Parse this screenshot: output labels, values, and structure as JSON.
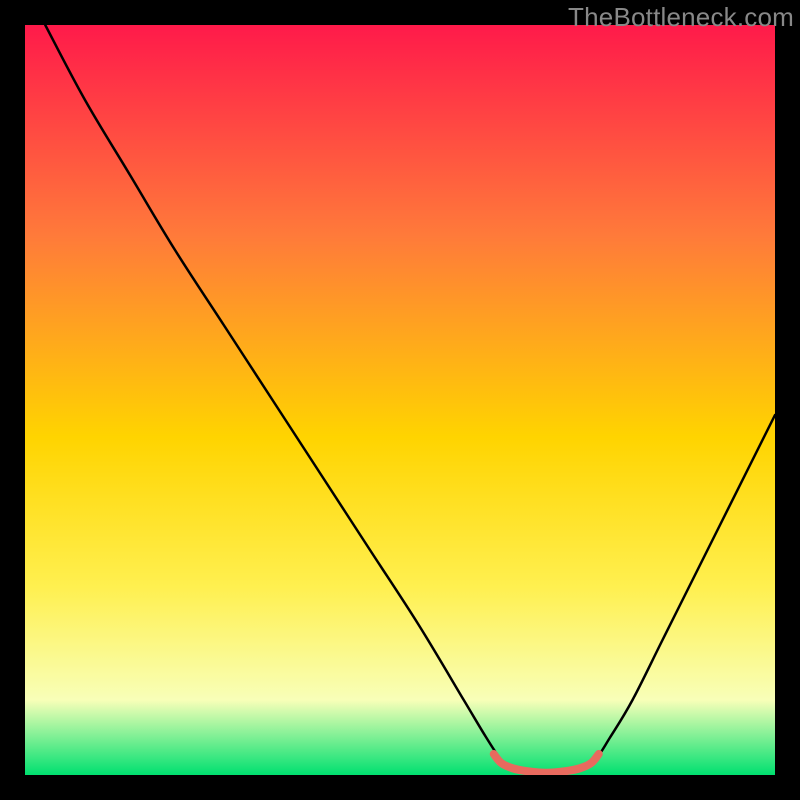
{
  "watermark": "TheBottleneck.com",
  "chart_data": {
    "type": "line",
    "title": "",
    "xlabel": "",
    "ylabel": "",
    "xlim": [
      0,
      100
    ],
    "ylim": [
      0,
      100
    ],
    "axes_visible": false,
    "background_gradient": {
      "top": "#ff1a4a",
      "mid1": "#ff7a3a",
      "mid2": "#ffd400",
      "mid3": "#fff050",
      "mid4": "#f8ffb8",
      "bottom": "#00e070"
    },
    "series": [
      {
        "name": "bottleneck-curve",
        "stroke": "#000000",
        "points": [
          {
            "x": 2.7,
            "y": 100.0
          },
          {
            "x": 8.0,
            "y": 90.0
          },
          {
            "x": 14.0,
            "y": 80.0
          },
          {
            "x": 20.0,
            "y": 70.0
          },
          {
            "x": 26.5,
            "y": 60.0
          },
          {
            "x": 33.0,
            "y": 50.0
          },
          {
            "x": 39.5,
            "y": 40.0
          },
          {
            "x": 46.0,
            "y": 30.0
          },
          {
            "x": 52.5,
            "y": 20.0
          },
          {
            "x": 58.5,
            "y": 10.0
          },
          {
            "x": 61.5,
            "y": 5.0
          },
          {
            "x": 63.5,
            "y": 2.0
          },
          {
            "x": 65.0,
            "y": 0.7
          },
          {
            "x": 68.0,
            "y": 0.3
          },
          {
            "x": 71.0,
            "y": 0.3
          },
          {
            "x": 74.0,
            "y": 0.7
          },
          {
            "x": 76.0,
            "y": 2.0
          },
          {
            "x": 78.0,
            "y": 5.0
          },
          {
            "x": 81.0,
            "y": 10.0
          },
          {
            "x": 85.0,
            "y": 18.0
          },
          {
            "x": 89.0,
            "y": 26.0
          },
          {
            "x": 93.0,
            "y": 34.0
          },
          {
            "x": 97.0,
            "y": 42.0
          },
          {
            "x": 100.0,
            "y": 48.0
          }
        ]
      },
      {
        "name": "highlight-segment",
        "stroke": "#e86a5e",
        "stroke_width": 8,
        "points": [
          {
            "x": 62.5,
            "y": 2.8
          },
          {
            "x": 63.5,
            "y": 1.6
          },
          {
            "x": 65.0,
            "y": 0.9
          },
          {
            "x": 67.0,
            "y": 0.5
          },
          {
            "x": 69.5,
            "y": 0.3
          },
          {
            "x": 72.0,
            "y": 0.5
          },
          {
            "x": 74.0,
            "y": 0.9
          },
          {
            "x": 75.5,
            "y": 1.6
          },
          {
            "x": 76.5,
            "y": 2.8
          }
        ]
      }
    ]
  }
}
